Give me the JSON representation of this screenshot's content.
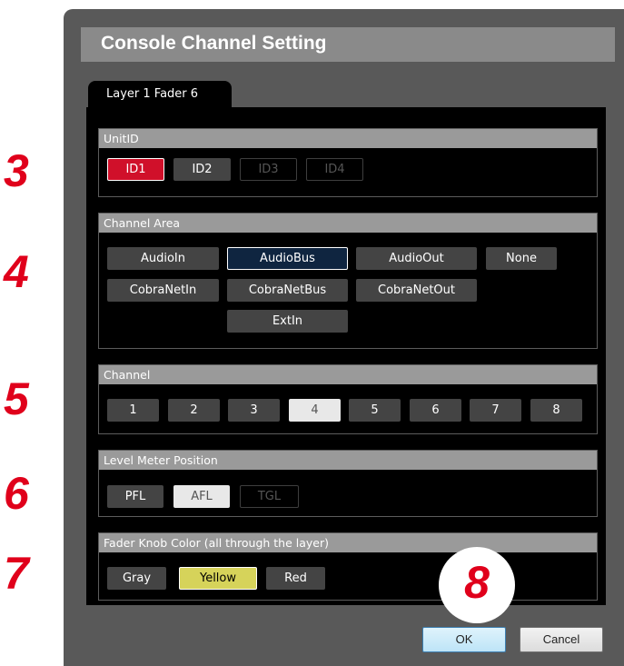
{
  "dialog": {
    "title": "Console Channel Setting",
    "tab_label": "Layer 1  Fader 6",
    "ok_label": "OK",
    "cancel_label": "Cancel"
  },
  "annotations": [
    "3",
    "4",
    "5",
    "6",
    "7",
    "8"
  ],
  "sections": {
    "unit_id": {
      "header": "UnitID",
      "buttons": [
        "ID1",
        "ID2",
        "ID3",
        "ID4"
      ],
      "selected": "ID1",
      "disabled": [
        "ID3",
        "ID4"
      ]
    },
    "channel_area": {
      "header": "Channel Area",
      "buttons": [
        "AudioIn",
        "AudioBus",
        "AudioOut",
        "None",
        "CobraNetIn",
        "CobraNetBus",
        "CobraNetOut",
        "ExtIn"
      ],
      "selected": "AudioBus"
    },
    "channel": {
      "header": "Channel",
      "buttons": [
        "1",
        "2",
        "3",
        "4",
        "5",
        "6",
        "7",
        "8"
      ],
      "selected": "4"
    },
    "level_meter": {
      "header": "Level Meter Position",
      "buttons": [
        "PFL",
        "AFL",
        "TGL"
      ],
      "selected": "AFL",
      "disabled": [
        "TGL"
      ]
    },
    "fader_color": {
      "header": "Fader Knob Color (all through the layer)",
      "buttons": [
        "Gray",
        "Yellow",
        "Red"
      ],
      "selected": "Yellow"
    }
  },
  "colors": {
    "annotation": "#e0001b",
    "selected_red": "#d0102a",
    "selected_navy": "#0f2540",
    "selected_yellow": "#d6d35a",
    "dialog_bg": "#595959"
  }
}
